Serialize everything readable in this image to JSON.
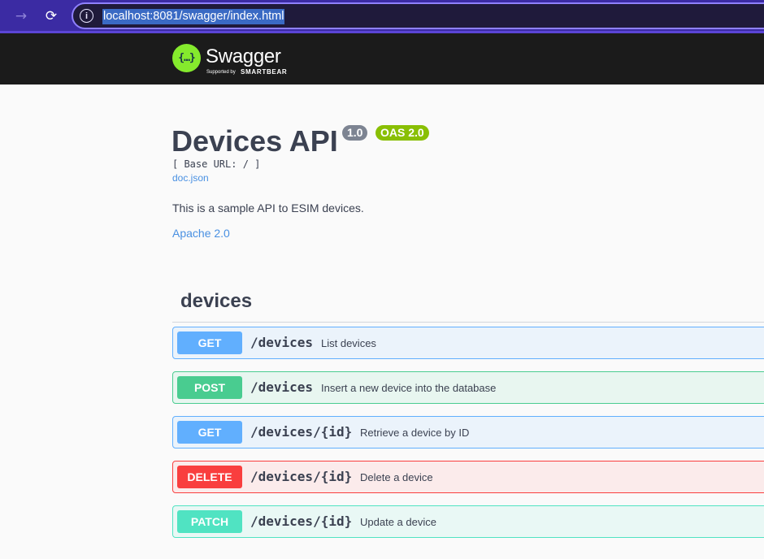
{
  "browser": {
    "forward_icon": "→",
    "reload_icon": "⟳",
    "site_info_icon": "i",
    "url": "localhost:8081/swagger/index.html"
  },
  "topbar": {
    "logo_glyph": "{…}",
    "logo_title": "Swagger",
    "logo_sub_small": "Supported by",
    "logo_sub_big": "SMARTBEAR"
  },
  "info": {
    "title": "Devices API",
    "version": "1.0",
    "oas": "OAS 2.0",
    "base_url": "[ Base URL: / ]",
    "doc_link": "doc.json",
    "description": "This is a sample API to ESIM devices.",
    "license": "Apache 2.0"
  },
  "tag": {
    "name": "devices"
  },
  "operations": [
    {
      "method": "GET",
      "path": "/devices",
      "summary": "List devices"
    },
    {
      "method": "POST",
      "path": "/devices",
      "summary": "Insert a new device into the database"
    },
    {
      "method": "GET",
      "path": "/devices/{id}",
      "summary": "Retrieve a device by ID"
    },
    {
      "method": "DELETE",
      "path": "/devices/{id}",
      "summary": "Delete a device"
    },
    {
      "method": "PATCH",
      "path": "/devices/{id}",
      "summary": "Update a device"
    }
  ],
  "colors": {
    "get": "#61affe",
    "post": "#49cc90",
    "delete": "#f93e3e",
    "patch": "#50e3c2",
    "logo": "#85ea2d"
  }
}
